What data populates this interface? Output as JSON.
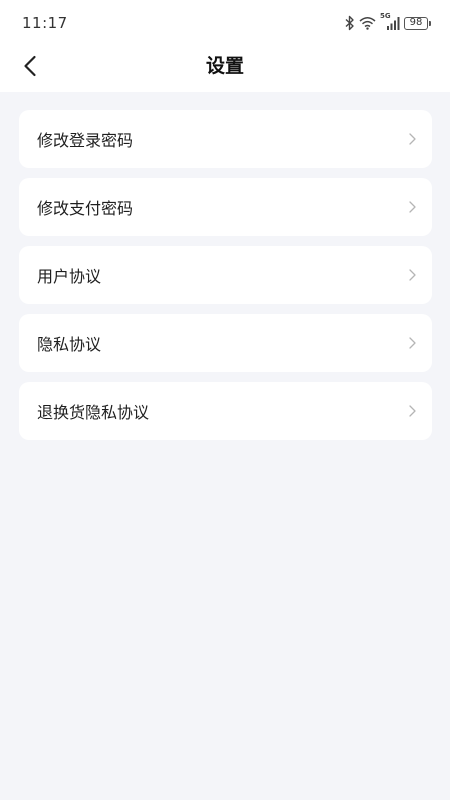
{
  "status_bar": {
    "time": "11:17",
    "battery": "98",
    "network": "5G",
    "icons": [
      "bluetooth-icon",
      "wifi-icon",
      "signal-icon",
      "battery-icon"
    ]
  },
  "header": {
    "title": "设置",
    "back_icon": "chevron-left-icon"
  },
  "menu": {
    "items": [
      {
        "label": "修改登录密码"
      },
      {
        "label": "修改支付密码"
      },
      {
        "label": "用户协议"
      },
      {
        "label": "隐私协议"
      },
      {
        "label": "退换货隐私协议"
      }
    ],
    "item_icon": "chevron-right-icon"
  },
  "colors": {
    "background": "#f4f5f9",
    "card": "#ffffff",
    "text": "#1f1f1f",
    "chevron": "#b5b5b5"
  }
}
